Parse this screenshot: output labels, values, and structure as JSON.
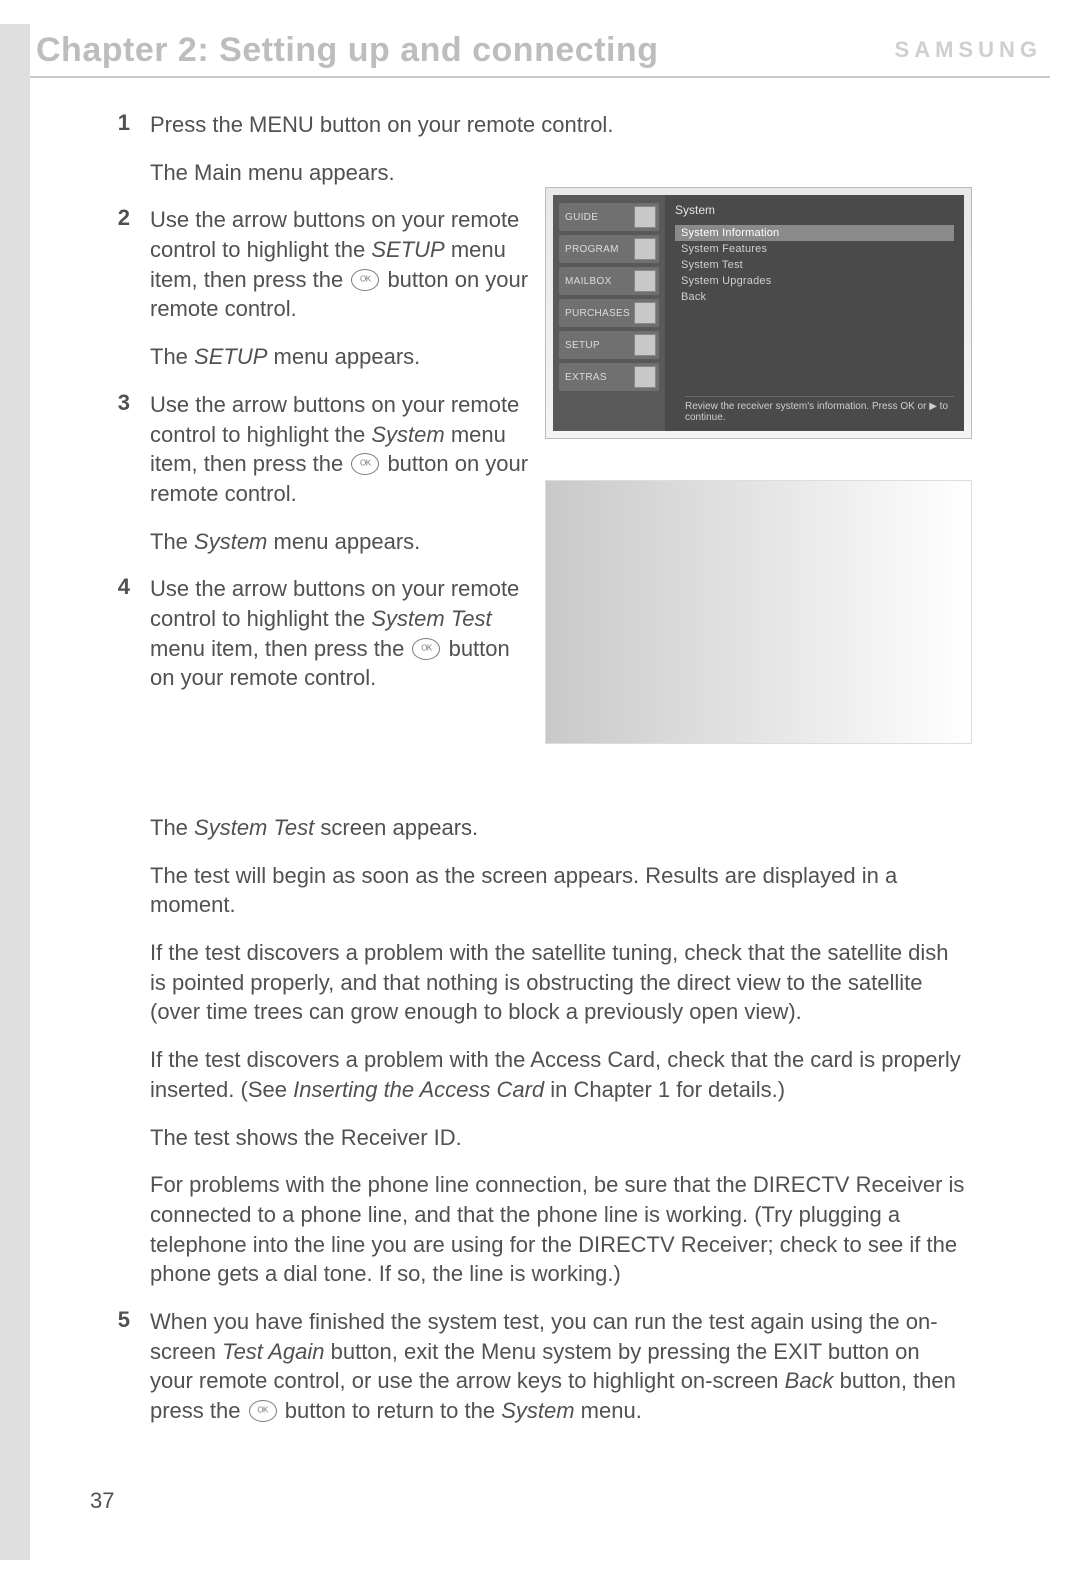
{
  "header": {
    "chapter_title": "Chapter 2: Setting up and connecting",
    "brand": "SAMSUNG"
  },
  "page_number": "37",
  "steps": [
    {
      "num": "1",
      "segments": [
        [
          {
            "t": "Press the MENU button on your remote control."
          }
        ]
      ],
      "after": [
        [
          {
            "t": "The Main menu appears."
          }
        ]
      ]
    },
    {
      "num": "2",
      "segments": [
        [
          {
            "t": "Use the arrow buttons on your remote control to highlight the "
          },
          {
            "t": "SETUP",
            "i": true
          },
          {
            "t": " menu item, then press the "
          },
          {
            "ok": true
          },
          {
            "t": " button on your remote control."
          }
        ]
      ],
      "after": [
        [
          {
            "t": "The "
          },
          {
            "t": "SETUP",
            "i": true
          },
          {
            "t": " menu appears."
          }
        ]
      ]
    },
    {
      "num": "3",
      "segments": [
        [
          {
            "t": "Use the arrow buttons on your remote control to highlight the "
          },
          {
            "t": "System",
            "i": true
          },
          {
            "t": " menu item, then press the "
          },
          {
            "ok": true
          },
          {
            "t": " button on your remote control."
          }
        ]
      ],
      "after": [
        [
          {
            "t": "The "
          },
          {
            "t": "System",
            "i": true
          },
          {
            "t": " menu appears."
          }
        ]
      ]
    },
    {
      "num": "4",
      "segments": [
        [
          {
            "t": "Use the arrow buttons on your remote control to highlight the "
          },
          {
            "t": "System Test",
            "i": true
          },
          {
            "t": " menu item, then press the "
          },
          {
            "ok": true
          },
          {
            "t": " button on your remote control."
          }
        ]
      ],
      "after": []
    }
  ],
  "followup_paras": [
    [
      {
        "t": "The "
      },
      {
        "t": "System Test",
        "i": true
      },
      {
        "t": " screen appears."
      }
    ],
    [
      {
        "t": "The test will begin as soon as the screen appears. Results are displayed in a moment."
      }
    ],
    [
      {
        "t": "If the test discovers a problem with the satellite tuning, check that the satellite dish is pointed properly, and that nothing is obstructing the direct view to the satellite (over time trees can grow enough to block a previously open view)."
      }
    ],
    [
      {
        "t": "If the test discovers a problem with the Access Card, check that the card is properly inserted. (See "
      },
      {
        "t": "Inserting the Access Card",
        "i": true
      },
      {
        "t": " in Chapter 1 for details.)"
      }
    ],
    [
      {
        "t": "The test shows the Receiver ID."
      }
    ],
    [
      {
        "t": "For problems with the phone line connection, be sure that the DIRECTV Receiver is connected to a phone line, and that the phone line is working. (Try plugging a telephone into the line you are using for the DIRECTV Receiver; check to see if the phone gets a dial tone. If so, the line is working.)"
      }
    ]
  ],
  "step5": {
    "num": "5",
    "segments": [
      [
        {
          "t": "When you have finished the system test, you can run the test again using the on-screen "
        },
        {
          "t": "Test Again",
          "i": true
        },
        {
          "t": " button, exit the Menu system by pressing the EXIT button on your remote control, or use the arrow keys to highlight on-screen "
        },
        {
          "t": "Back",
          "i": true
        },
        {
          "t": " button, then press the "
        },
        {
          "ok": true
        },
        {
          "t": " button to return to the "
        },
        {
          "t": "System",
          "i": true
        },
        {
          "t": " menu."
        }
      ]
    ]
  },
  "tv": {
    "tabs": [
      "GUIDE",
      "PROGRAM",
      "MAILBOX",
      "PURCHASES",
      "SETUP",
      "EXTRAS"
    ],
    "title": "System",
    "items": [
      "System Information",
      "System Features",
      "System Test",
      "System Upgrades",
      "Back"
    ],
    "selected_index": 0,
    "hint": "Review the receiver system's information. Press OK or ▶ to continue."
  }
}
